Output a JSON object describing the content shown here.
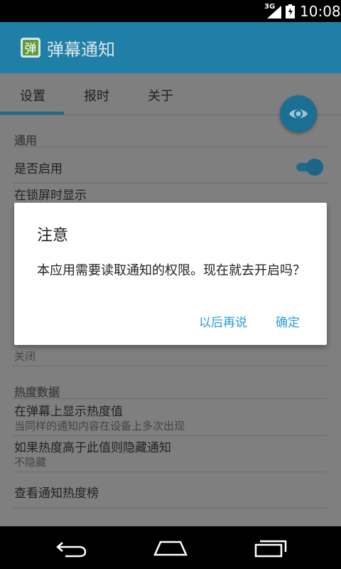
{
  "status_bar": {
    "network": "3G",
    "time": "10:08"
  },
  "app_bar": {
    "title": "弹幕通知",
    "logo_glyph": "弹"
  },
  "tabs": [
    {
      "label": "设置",
      "selected": true
    },
    {
      "label": "报时",
      "selected": false
    },
    {
      "label": "关于",
      "selected": false
    }
  ],
  "settings": {
    "general_header": "通用",
    "enable_label": "是否启用",
    "enable_on": true,
    "lockscreen_label": "在锁屏时显示",
    "lockscreen_value": "关闭",
    "heat_header": "热度数据",
    "show_heat_label": "在弹幕上显示热度值",
    "show_heat_sub": "当同样的通知内容在设备上多次出现",
    "hide_above_label": "如果热度高于此值则隐藏通知",
    "hide_above_sub": "不隐藏",
    "view_rank_label": "查看通知热度榜"
  },
  "fab_icon": "eye-icon",
  "dialog": {
    "title": "注意",
    "message": "本应用需要读取通知的权限。现在就去开启吗？",
    "negative_label": "以后再说",
    "positive_label": "确定"
  },
  "nav_icons": [
    "back-icon",
    "home-icon",
    "recents-icon"
  ],
  "colors": {
    "accent": "#2b9ed6",
    "primary": "#1f7fa6"
  }
}
